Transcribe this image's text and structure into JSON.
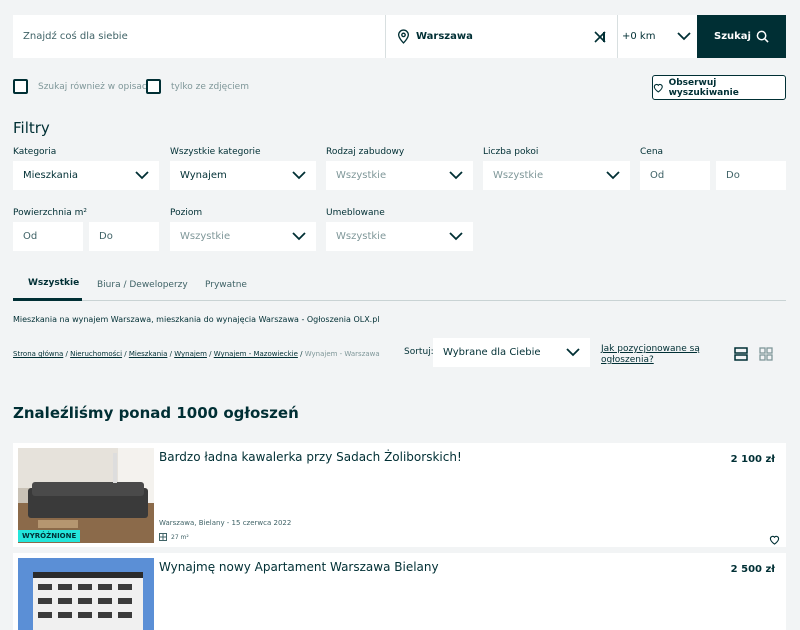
{
  "search": {
    "placeholder": "Znajdź coś dla siebie",
    "location": "Warszawa",
    "distance": "+0 km",
    "button_label": "Szukaj"
  },
  "options": {
    "search_descriptions": "Szukaj również w opisach",
    "only_with_photo": "tylko ze zdjęciem",
    "observe_button": "Obserwuj wyszukiwanie"
  },
  "filters": {
    "title": "Filtry",
    "category": {
      "label": "Kategoria",
      "value": "Mieszkania"
    },
    "all_categories": {
      "label": "Wszystkie kategorie",
      "value": "Wynajem"
    },
    "building_type": {
      "label": "Rodzaj zabudowy",
      "value": "Wszystkie"
    },
    "rooms": {
      "label": "Liczba pokoi",
      "value": "Wszystkie"
    },
    "price": {
      "label": "Cena",
      "from": "Od",
      "to": "Do"
    },
    "area": {
      "label": "Powierzchnia m²",
      "from": "Od",
      "to": "Do"
    },
    "level": {
      "label": "Poziom",
      "value": "Wszystkie"
    },
    "furnished": {
      "label": "Umeblowane",
      "value": "Wszystkie"
    }
  },
  "tabs": [
    {
      "label": "Wszystkie",
      "active": true
    },
    {
      "label": "Biura / Deweloperzy",
      "active": false
    },
    {
      "label": "Prywatne",
      "active": false
    }
  ],
  "seo_text": "Mieszkania na wynajem Warszawa, mieszkania do wynajęcia Warszawa - Ogłoszenia OLX.pl",
  "breadcrumbs": {
    "home": "Strona główna",
    "realestate": "Nieruchomości",
    "apartments": "Mieszkania",
    "rent": "Wynajem",
    "region": "Wynajem - Mazowieckie",
    "current": "Wynajem - Warszawa"
  },
  "sort": {
    "label": "Sortuj:",
    "value": "Wybrane dla Ciebie",
    "how_link_1": "Jak pozycjonowane są",
    "how_link_2": "ogłoszenia?"
  },
  "results_heading": "Znaleźliśmy ponad 1000 ogłoszeń",
  "listings": [
    {
      "title": "Bardzo ładna kawalerka przy Sadach Żoliborskich!",
      "price": "2 100 zł",
      "location_date": "Warszawa, Bielany - 15 czerwca 2022",
      "area": "27 m²",
      "badge": "WYRÓŻNIONE"
    },
    {
      "title": "Wynajmę nowy Apartament Warszawa Bielany",
      "price": "2 500 zł"
    }
  ],
  "colors": {
    "primary": "#002f34",
    "badge": "#23e5db",
    "background": "#f2f4f5"
  }
}
